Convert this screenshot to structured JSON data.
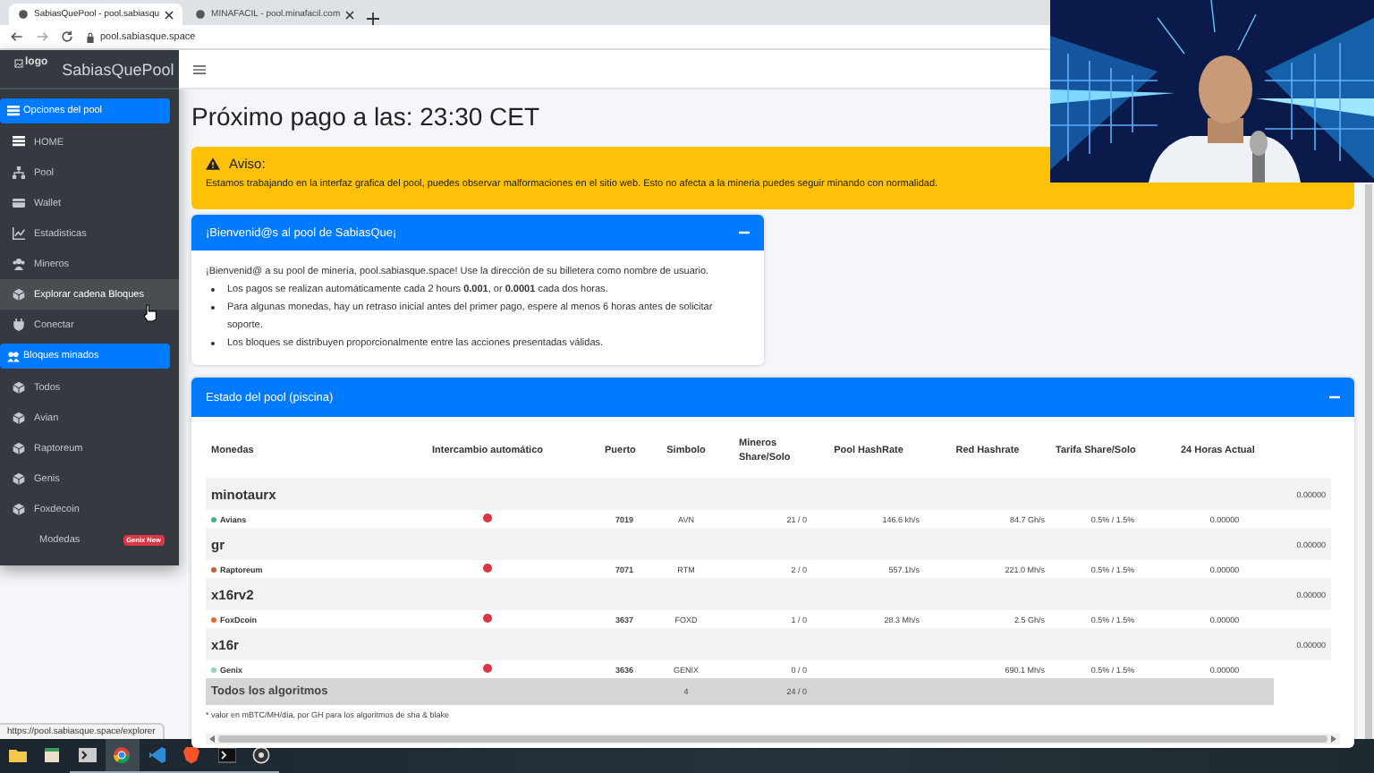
{
  "browser": {
    "tabs": [
      {
        "title": "SabiasQuePool - pool.sabiasqu",
        "selected": true
      },
      {
        "title": "MINAFACIL - pool.minafacil.com",
        "selected": false
      }
    ],
    "address": "pool.sabiasque.space"
  },
  "sidebar": {
    "logo_alt": "logo",
    "brand": "SabiasQuePool",
    "items": [
      {
        "kind": "header",
        "label": "Opciones del pool",
        "hovered": false
      },
      {
        "kind": "link",
        "label": "HOME",
        "hovered": false
      },
      {
        "kind": "link",
        "label": "Pool",
        "hovered": false
      },
      {
        "kind": "link",
        "label": "Wallet",
        "hovered": false
      },
      {
        "kind": "link",
        "label": "Estadisticas",
        "hovered": false
      },
      {
        "kind": "link",
        "label": "Mineros",
        "hovered": false
      },
      {
        "kind": "link",
        "label": "Explorar cadena Bloques",
        "hovered": true
      },
      {
        "kind": "link",
        "label": "Conectar",
        "hovered": false
      },
      {
        "kind": "header",
        "label": "Bloques minados",
        "hovered": false
      },
      {
        "kind": "link",
        "label": "Todos",
        "hovered": false
      },
      {
        "kind": "link",
        "label": "Avian",
        "hovered": false
      },
      {
        "kind": "link",
        "label": "Raptoreum",
        "hovered": false
      },
      {
        "kind": "link",
        "label": "Genis",
        "hovered": false
      },
      {
        "kind": "link",
        "label": "Foxdecoin",
        "hovered": false
      },
      {
        "kind": "link",
        "label": "Modedas",
        "badge": "Genix New",
        "hovered": false
      }
    ]
  },
  "page_title": "Próximo pago a las: 23:30 CET",
  "alert": {
    "title": "Aviso:",
    "text": "Estamos trabajando en la interfaz grafica del pool, puedes observar malformaciones en el sitio web. Esto no afecta a la mineria puedes seguir minando con normalidad."
  },
  "welcome_card": {
    "title": "¡Bienvenid@s al pool de SabiasQue¡",
    "intro": "¡Bienvenid@ a su pool de minería, pool.sabiasque.space! Use la dirección de su billetera como nombre de usuario.",
    "bullets": [
      "Los pagos se realizan automáticamente cada 2 hours **0.001**, or **0.0001** cada dos horas.",
      "Para algunas monedas, hay un retraso inicial antes del primer pago, espere al menos 6 horas antes de solicitar soporte.",
      "Los bloques se distribuyen proporcionalmente entre las acciones presentadas válidas."
    ]
  },
  "pool_card": {
    "title": "Estado del pool (piscina)",
    "columns": [
      "Monedas",
      "Intercambio automático",
      "Puerto",
      "Simbolo",
      "Mineros Share/Solo",
      "Pool HashRate",
      "Red Hashrate",
      "Tarifa Share/Solo",
      "24 Horas Actual"
    ],
    "groups": [
      {
        "name": "minotaurx",
        "value": "0.00000",
        "coins": [
          {
            "name": "Avians",
            "color": "#4caf7a",
            "auto_exchange": false,
            "port": "7019",
            "symbol": "AVN",
            "miners": "21 / 0",
            "pool_hashrate": "146.6 kh/s",
            "net_hashrate": "84.7 Gh/s",
            "fee": "0.5% / 1.5%",
            "actual_24h": "0.00000"
          }
        ]
      },
      {
        "name": "gr",
        "value": "0.00000",
        "coins": [
          {
            "name": "Raptoreum",
            "color": "#c0603a",
            "auto_exchange": false,
            "port": "7071",
            "symbol": "RTM",
            "miners": "2 / 0",
            "pool_hashrate": "557.1h/s",
            "net_hashrate": "221.0 Mh/s",
            "fee": "0.5% / 1.5%",
            "actual_24h": "0.00000"
          }
        ]
      },
      {
        "name": "x16rv2",
        "value": "0.00000",
        "coins": [
          {
            "name": "FoxDcoin",
            "color": "#e8692d",
            "auto_exchange": false,
            "port": "3637",
            "symbol": "FOXD",
            "miners": "1 / 0",
            "pool_hashrate": "28.3 Mh/s",
            "net_hashrate": "2.5 Gh/s",
            "fee": "0.5% / 1.5%",
            "actual_24h": "0.00000"
          }
        ]
      },
      {
        "name": "x16r",
        "value": "0.00000",
        "coins": [
          {
            "name": "Genix",
            "color": "#8fd3c0",
            "auto_exchange": false,
            "port": "3636",
            "symbol": "GENIX",
            "miners": "0 / 0",
            "net_hashrate": "690.1 Mh/s",
            "fee": "0.5% / 1.5%",
            "actual_24h": "0.00000"
          }
        ]
      }
    ],
    "totals": {
      "label": "Todos los algoritmos",
      "coins": "4",
      "miners": "24 / 0"
    },
    "footnote": "* valor en mBTC/MH/día, por GH para los algoritmos de sha & blake"
  },
  "status_link": "https://pool.sabiasque.space/explorer"
}
